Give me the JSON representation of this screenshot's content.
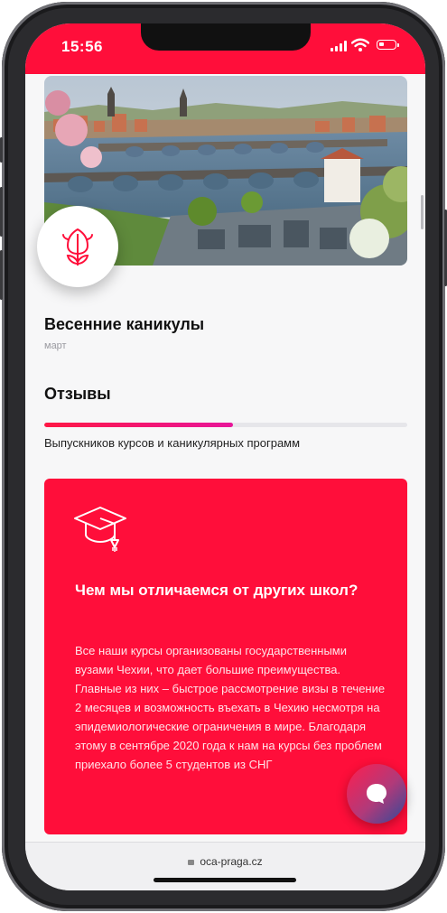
{
  "status_bar": {
    "time": "15:56"
  },
  "hero": {
    "badge_icon": "tulip-icon"
  },
  "event": {
    "title": "Весенние каникулы",
    "month": "март"
  },
  "reviews": {
    "heading": "Отзывы",
    "progress": 0.52,
    "caption": "Выпускников курсов и каникулярных программ"
  },
  "card": {
    "icon": "graduation-cap-icon",
    "heading": "Чем мы отличаемся от других школ?",
    "text": "Все наши курсы организованы государственными вузами Чехии, что дает большие преимущества. Главные из них – быстрое рассмотрение визы в течение 2 месяцев и возможность въехать в Чехию несмотря на эпидемиологические ограничения в мире. Благодаря этому в сентябре 2020 года к нам на курсы без проблем приехало более 5 студентов из СНГ"
  },
  "chat": {
    "icon": "chat-bubble-icon"
  },
  "browser": {
    "url": "oca-praga.cz"
  },
  "colors": {
    "accent": "#ff0e3a",
    "progress_end": "#e8169a"
  }
}
